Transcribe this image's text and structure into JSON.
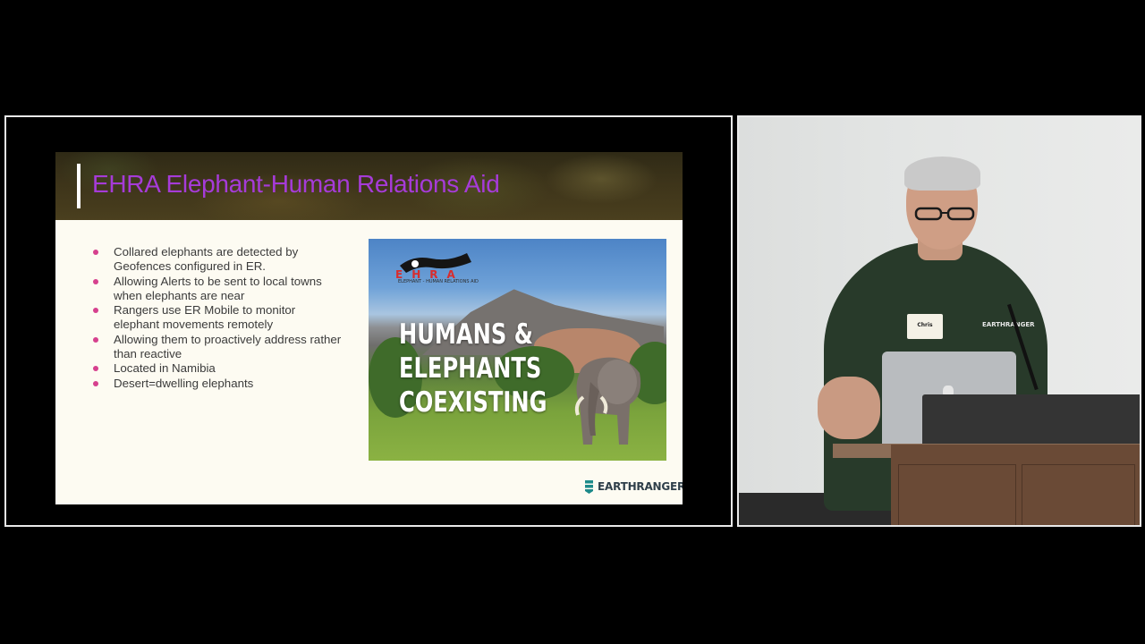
{
  "slide": {
    "title": "EHRA Elephant-Human Relations Aid",
    "bullets": [
      "Collared elephants are detected by Geofences configured in ER.",
      "Allowing Alerts to be sent to local towns when elephants are near",
      "Rangers use ER Mobile to monitor elephant movements remotely",
      "Allowing them to proactively address rather than reactive",
      "Located in Namibia",
      "Desert=dwelling elephants"
    ],
    "image": {
      "logo_text": "EHRA",
      "logo_subtitle": "ELEPHANT - HUMAN RELATIONS AID",
      "headline_lines": [
        "HUMANS &",
        "ELEPHANTS",
        "COEXISTING"
      ]
    },
    "brand_logo": "EARTHRANGER",
    "colors": {
      "title": "#a63bd8",
      "bullet": "#d6408e",
      "slide_bg": "#fdfbf2"
    }
  },
  "camera": {
    "name_badge": "Chris",
    "shirt_logo": "EARTHRANGER"
  }
}
